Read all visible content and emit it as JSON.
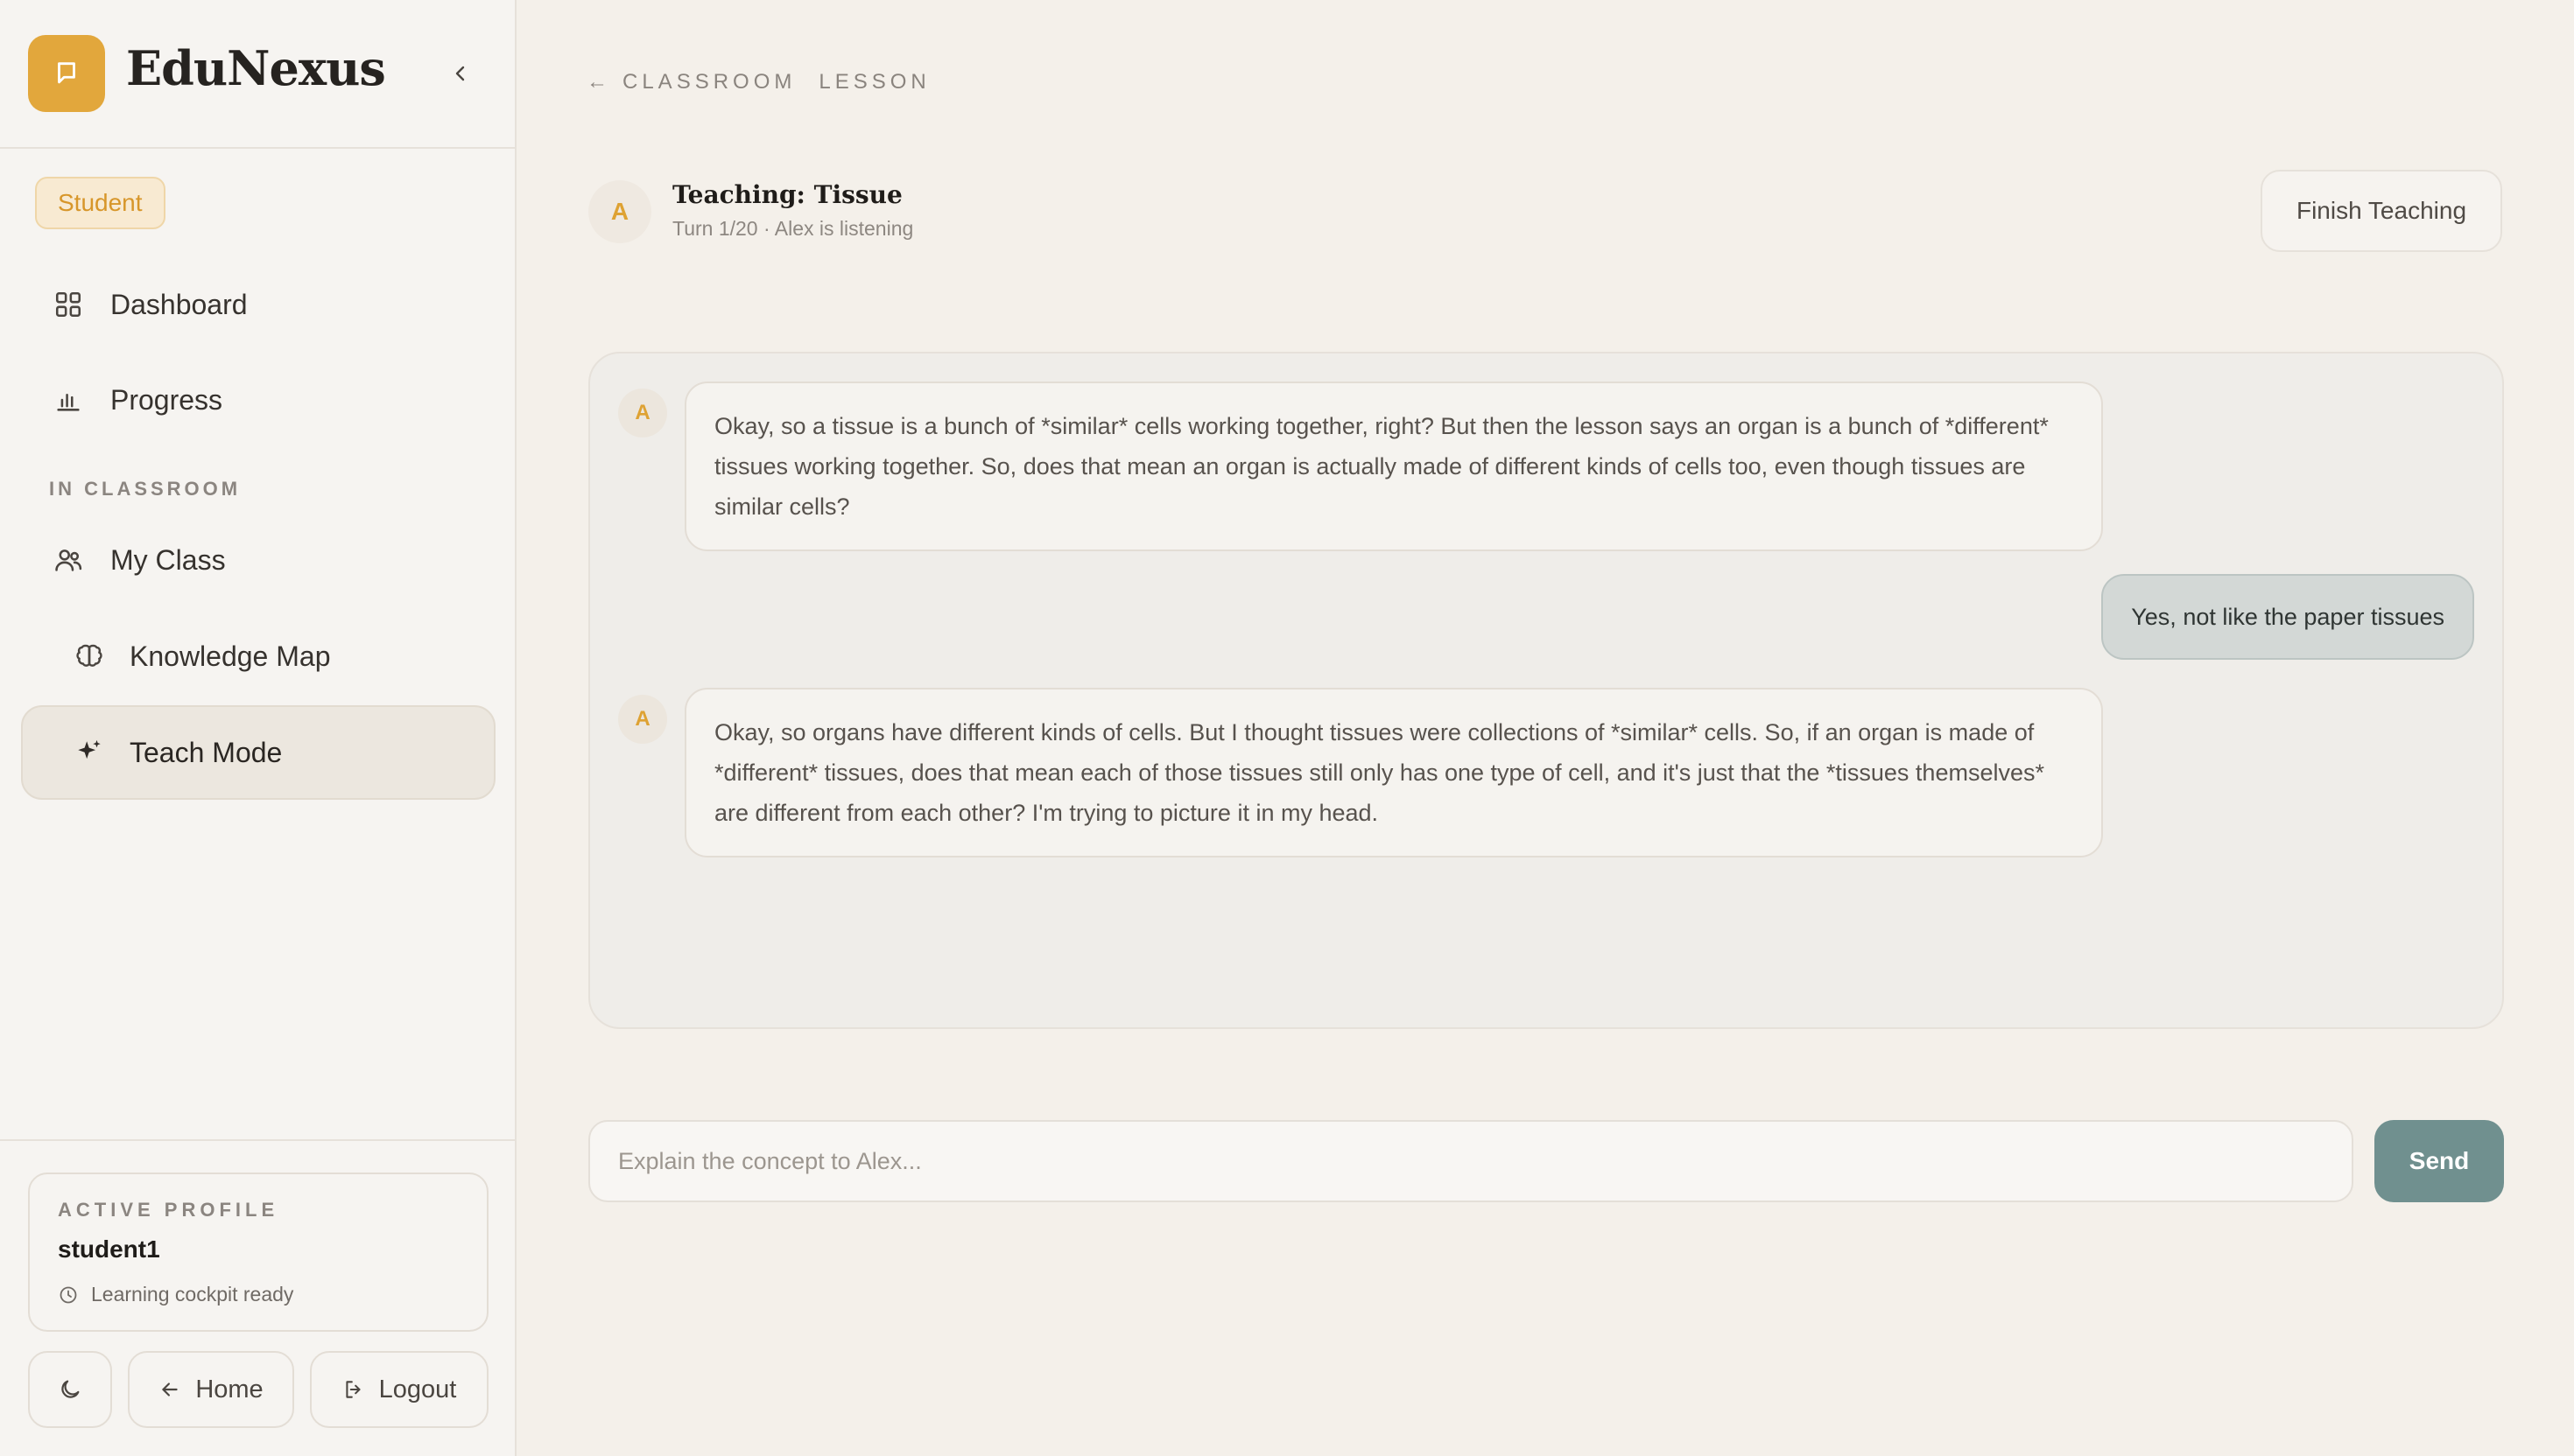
{
  "brand": {
    "name": "EduNexus",
    "logo_icon": "chat-bubble-icon",
    "accent": "#e2a73c"
  },
  "sidebar": {
    "role": "Student",
    "items": [
      {
        "label": "Dashboard",
        "icon": "grid-icon"
      },
      {
        "label": "Progress",
        "icon": "bar-chart-icon"
      }
    ],
    "section_label": "IN CLASSROOM",
    "classroom_items": [
      {
        "label": "My Class",
        "icon": "users-icon"
      },
      {
        "label": "Knowledge Map",
        "icon": "brain-icon"
      },
      {
        "label": "Teach Mode",
        "icon": "sparkle-icon",
        "active": true
      }
    ],
    "profile": {
      "caption": "ACTIVE PROFILE",
      "username": "student1",
      "status": "Learning cockpit ready"
    },
    "footer_buttons": {
      "theme_icon": "moon-icon",
      "home": "Home",
      "logout": "Logout"
    }
  },
  "main": {
    "breadcrumb": {
      "back_arrow": "←",
      "classroom": "CLASSROOM",
      "lesson": "LESSON"
    },
    "header": {
      "avatar_initial": "A",
      "title": "Teaching: Tissue",
      "subtitle": "Turn 1/20 · Alex is listening",
      "finish_label": "Finish Teaching"
    },
    "messages": [
      {
        "role": "ai",
        "avatar": "A",
        "text": "Okay, so a tissue is a bunch of *similar* cells working together, right? But then the lesson says an organ is a bunch of *different* tissues working together. So, does that mean an organ is actually made of different kinds of cells too, even though tissues are similar cells?"
      },
      {
        "role": "user",
        "text": "Yes, not like the paper tissues"
      },
      {
        "role": "ai",
        "avatar": "A",
        "text": "Okay, so organs have different kinds of cells. But I thought tissues were collections of *similar* cells. So, if an organ is made of *different* tissues, does that mean each of those tissues still only has one type of cell, and it's just that the *tissues themselves* are different from each other? I'm trying to picture it in my head."
      }
    ],
    "composer": {
      "placeholder": "Explain the concept to Alex...",
      "value": "",
      "send_label": "Send"
    }
  }
}
